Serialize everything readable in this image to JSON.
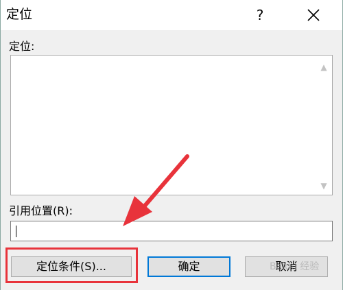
{
  "dialog": {
    "title": "定位",
    "help_label": "?",
    "goto_label": "定位:",
    "reference_label": "引用位置(R):",
    "reference_value": ""
  },
  "buttons": {
    "special": "定位条件(S)...",
    "ok": "确定",
    "cancel": "取消"
  },
  "watermark": {
    "text": "Baidu 经验"
  },
  "colors": {
    "highlight": "#e8333b",
    "arrow": "#e8333b",
    "focus": "#0078d7"
  }
}
